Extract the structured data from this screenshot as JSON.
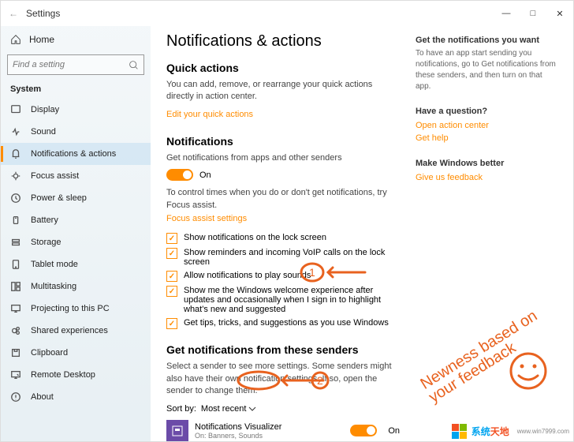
{
  "title": "Settings",
  "winbuttons": {
    "min": "—",
    "max": "□",
    "close": "✕"
  },
  "home": "Home",
  "search": {
    "placeholder": "Find a setting"
  },
  "section": "System",
  "nav": [
    {
      "label": "Display"
    },
    {
      "label": "Sound"
    },
    {
      "label": "Notifications & actions"
    },
    {
      "label": "Focus assist"
    },
    {
      "label": "Power & sleep"
    },
    {
      "label": "Battery"
    },
    {
      "label": "Storage"
    },
    {
      "label": "Tablet mode"
    },
    {
      "label": "Multitasking"
    },
    {
      "label": "Projecting to this PC"
    },
    {
      "label": "Shared experiences"
    },
    {
      "label": "Clipboard"
    },
    {
      "label": "Remote Desktop"
    },
    {
      "label": "About"
    }
  ],
  "page": {
    "h1": "Notifications & actions",
    "qa": {
      "h": "Quick actions",
      "p": "You can add, remove, or rearrange your quick actions directly in action center.",
      "link": "Edit your quick actions"
    },
    "notif": {
      "h": "Notifications",
      "p": "Get notifications from apps and other senders",
      "on": "On",
      "focus_p": "To control times when you do or don't get notifications, try Focus assist.",
      "focus_link": "Focus assist settings",
      "checks": [
        "Show notifications on the lock screen",
        "Show reminders and incoming VoIP calls on the lock screen",
        "Allow notifications to play sounds",
        "Show me the Windows welcome experience after updates and occasionally when I sign in to highlight what's new and suggested",
        "Get tips, tricks, and suggestions as you use Windows"
      ]
    },
    "senders": {
      "h": "Get notifications from these senders",
      "p": "Select a sender to see more settings. Some senders might also have their own notification settings. If so, open the sender to change them.",
      "sort_label": "Sort by:",
      "sort_value": "Most recent",
      "item": {
        "name": "Notifications Visualizer",
        "sub": "On: Banners, Sounds",
        "state": "On"
      }
    }
  },
  "aside": {
    "a": {
      "h": "Get the notifications you want",
      "p": "To have an app start sending you notifications, go to Get notifications from these senders, and then turn on that app."
    },
    "b": {
      "h": "Have a question?",
      "l1": "Open action center",
      "l2": "Get help"
    },
    "c": {
      "h": "Make Windows better",
      "l": "Give us feedback"
    }
  },
  "ink_text": "Newness based on your feedback",
  "watermark": {
    "brand1": "系统",
    "brand2": "天地",
    "url": "www.win7999.com"
  }
}
